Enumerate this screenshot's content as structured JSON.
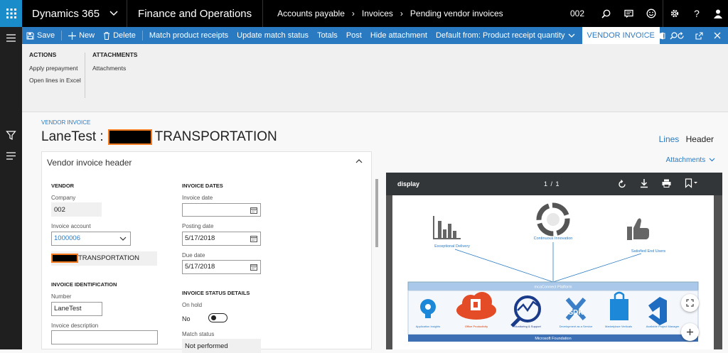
{
  "topbar": {
    "brand": "Dynamics 365",
    "module": "Finance and Operations",
    "breadcrumb": [
      "Accounts payable",
      "Invoices",
      "Pending vendor invoices"
    ],
    "company": "002"
  },
  "cmdbar": {
    "save": "Save",
    "new": "New",
    "delete": "Delete",
    "match": "Match product receipts",
    "update": "Update match status",
    "totals": "Totals",
    "post": "Post",
    "hide": "Hide attachment",
    "default_from": "Default from: Product receipt quantity",
    "tab": "VENDOR INVOICE",
    "more": "···"
  },
  "ribbon": {
    "actions_title": "ACTIONS",
    "actions": [
      "Apply prepayment",
      "Open lines in Excel"
    ],
    "attachments_title": "ATTACHMENTS",
    "attachments": [
      "Attachments"
    ]
  },
  "page": {
    "caption": "VENDOR INVOICE",
    "title_prefix": "LaneTest :",
    "title_suffix": "TRANSPORTATION",
    "lines": "Lines",
    "header": "Header",
    "attachments_link": "Attachments"
  },
  "panel": {
    "title": "Vendor invoice header",
    "vendor": {
      "title": "VENDOR",
      "company_label": "Company",
      "company": "002",
      "account_label": "Invoice account",
      "account": "1000006",
      "name": "TRANSPORTATION"
    },
    "ident": {
      "title": "INVOICE IDENTIFICATION",
      "number_label": "Number",
      "number": "LaneTest",
      "desc_label": "Invoice description",
      "desc": ""
    },
    "dates": {
      "title": "INVOICE DATES",
      "invoice_label": "Invoice date",
      "invoice": "",
      "posting_label": "Posting date",
      "posting": "5/17/2018",
      "due_label": "Due date",
      "due": "5/17/2018"
    },
    "status": {
      "title": "INVOICE STATUS DETAILS",
      "onhold_label": "On hold",
      "onhold": "No",
      "match_label": "Match status",
      "match": "Not performed"
    }
  },
  "viewer": {
    "title": "display",
    "pages": "1 / 1",
    "diagram": {
      "top": [
        "Exceptional Delivery",
        "Continuous Innovation",
        "Satisfied End Users"
      ],
      "platform": "mcaConnect Platform",
      "foundation": "Microsoft Foundation",
      "items": [
        "Application Insights",
        "Office Productivity",
        "Monitoring & Support",
        "Development as a Service",
        "Marketplace Verticals",
        "Available Project Manager"
      ]
    }
  },
  "colors": {
    "accent": "#2a7ac2",
    "office": "#d83b01",
    "redaction_border": "#f47b20"
  }
}
